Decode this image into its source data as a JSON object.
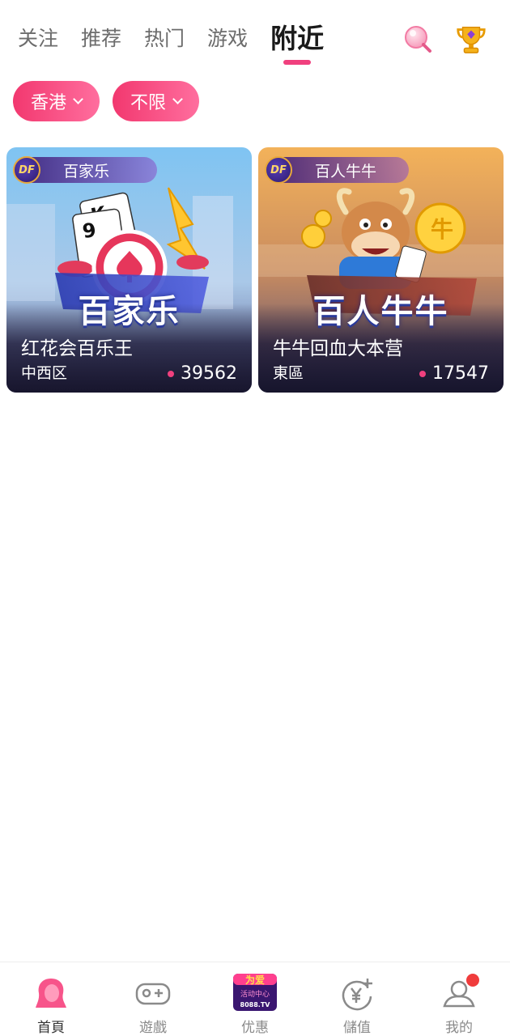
{
  "top_tabs": [
    {
      "label": "关注"
    },
    {
      "label": "推荐"
    },
    {
      "label": "热门"
    },
    {
      "label": "游戏"
    },
    {
      "label": "附近"
    }
  ],
  "active_tab": "附近",
  "top_icons": [
    "search-icon",
    "trophy-icon"
  ],
  "filters": [
    {
      "label": "香港"
    },
    {
      "label": "不限"
    }
  ],
  "cards": [
    {
      "tag_logo": "DF",
      "tag_label": "百家乐",
      "art_title": "百家乐",
      "name": "红花会百乐王",
      "area": "中西区",
      "count": "39562"
    },
    {
      "tag_logo": "DF",
      "tag_label": "百人牛牛",
      "art_title": "百人牛牛",
      "name": "牛牛回血大本营",
      "area": "東區",
      "count": "17547"
    }
  ],
  "bottom_nav": [
    {
      "label": "首頁",
      "icon": "home-girl-icon"
    },
    {
      "label": "遊戲",
      "icon": "gamepad-icon"
    },
    {
      "label": "优惠",
      "icon": "promo-banner-icon",
      "banner_text": "为爱",
      "banner_sub": "活动中心",
      "banner_site": "8088.TV"
    },
    {
      "label": "儲值",
      "icon": "yen-coin-icon"
    },
    {
      "label": "我的",
      "icon": "profile-icon"
    }
  ],
  "colors": {
    "accent": "#f0407e",
    "chip_start": "#f2386f",
    "chip_end": "#ff6e9e",
    "badge": "#f03c3c"
  }
}
